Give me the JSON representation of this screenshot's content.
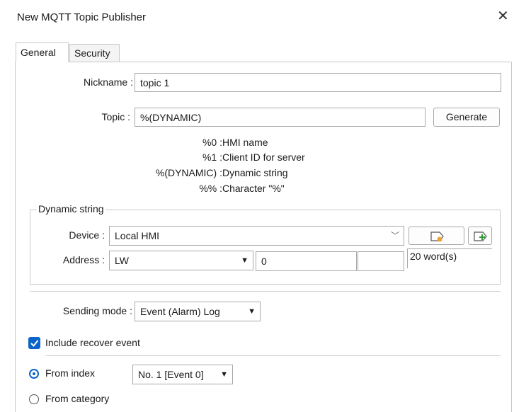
{
  "window": {
    "title": "New MQTT Topic Publisher"
  },
  "tabs": [
    {
      "label": "General"
    },
    {
      "label": "Security"
    }
  ],
  "general": {
    "nickname_label": "Nickname :",
    "nickname_value": "topic 1",
    "topic_label": "Topic :",
    "topic_value": "%(DYNAMIC)",
    "generate_button": "Generate",
    "legend": [
      {
        "key": "%0 :",
        "desc": "HMI name"
      },
      {
        "key": "%1 :",
        "desc": "Client ID for server"
      },
      {
        "key": "%(DYNAMIC) :",
        "desc": "Dynamic string"
      },
      {
        "key": "%% :",
        "desc": "Character \"%\""
      }
    ]
  },
  "dynamic_string": {
    "group_label": "Dynamic string",
    "device_label": "Device :",
    "device_value": "Local HMI",
    "address_label": "Address :",
    "address_type": "LW",
    "address_value": "0",
    "length_value": "20 word(s)"
  },
  "sending_mode": {
    "label": "Sending mode :",
    "value": "Event (Alarm) Log"
  },
  "include_recover": {
    "label": "Include recover event",
    "checked": true
  },
  "source": {
    "from_index_label": "From index",
    "from_index_value": "No. 1 [Event 0]",
    "from_category_label": "From category",
    "selected": "From index"
  },
  "colors": {
    "accent": "#0a64c8"
  }
}
